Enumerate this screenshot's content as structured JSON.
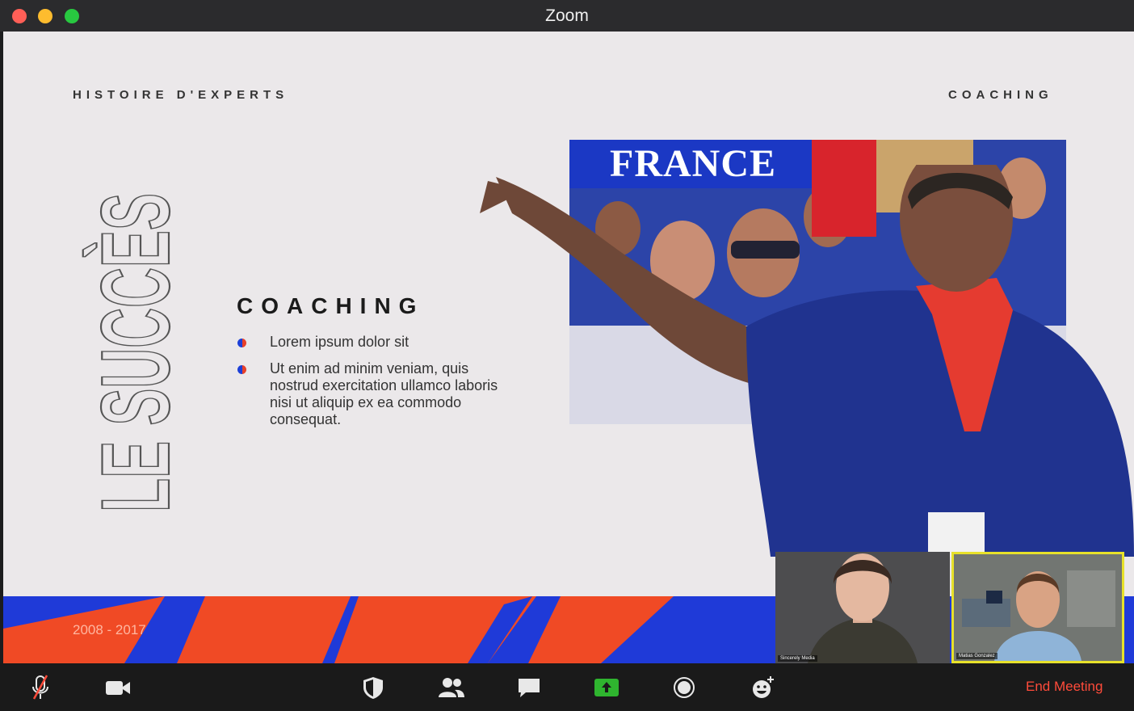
{
  "window": {
    "title": "Zoom"
  },
  "slide": {
    "label_left": "HISTOIRE D'EXPERTS",
    "label_right": "COACHING",
    "vertical_title": "LE SUCCÈS",
    "heading": "COACHING",
    "bullets": [
      "Lorem ipsum dolor sit",
      "Ut enim ad minim veniam, quis nostrud exercitation ullamco laboris nisi ut aliquip ex ea commodo consequat."
    ],
    "photo_banner": "FRANCE",
    "years": "2008 - 2017"
  },
  "participants": [
    {
      "name": "Sincerely Media"
    },
    {
      "name": "Matias Gonzalez",
      "active_speaker": true
    }
  ],
  "toolbar": {
    "items": [
      {
        "icon": "microphone-muted-icon"
      },
      {
        "icon": "video-camera-icon"
      },
      {
        "icon": "security-shield-icon"
      },
      {
        "icon": "participants-icon"
      },
      {
        "icon": "chat-icon"
      },
      {
        "icon": "share-screen-icon"
      },
      {
        "icon": "record-icon"
      },
      {
        "icon": "reactions-icon"
      }
    ],
    "end_meeting_label": "End Meeting"
  },
  "colors": {
    "accent_blue": "#1f3ad8",
    "accent_red": "#f04a25",
    "end_meeting": "#ff4b3a",
    "speaker_highlight": "#e7e12a",
    "share_green": "#2fb52f"
  }
}
